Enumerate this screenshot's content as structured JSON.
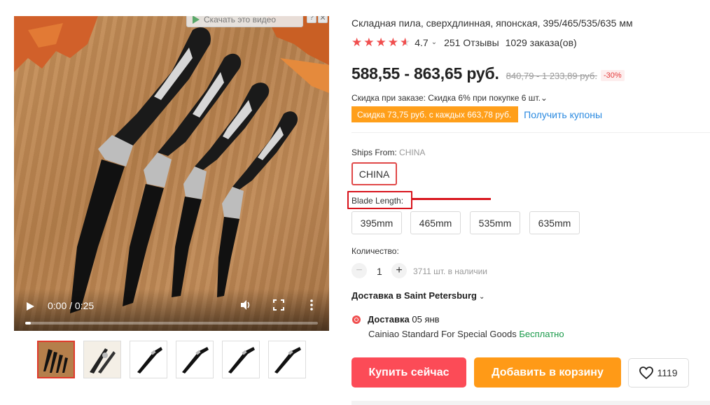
{
  "video": {
    "download_badge": "Скачать это видео",
    "help_glyph": "?",
    "close_glyph": "✕",
    "time": "0:00 / 0:25",
    "progress_fraction": 0.02
  },
  "thumbnails": [
    {
      "name": "thumbnail-1",
      "active": true
    },
    {
      "name": "thumbnail-2",
      "active": false
    },
    {
      "name": "thumbnail-3",
      "active": false
    },
    {
      "name": "thumbnail-4",
      "active": false
    },
    {
      "name": "thumbnail-5",
      "active": false
    },
    {
      "name": "thumbnail-6",
      "active": false
    }
  ],
  "product": {
    "title": "Складная пила, сверхдлинная, японская, 395/465/535/635 мм",
    "rating": "4.7",
    "rating_chevron": "⌄",
    "reviews": "251 Отзывы",
    "orders": "1029 заказа(ов)",
    "price": "588,55 - 863,65 руб.",
    "old_price": "840,79 - 1 233,89 руб.",
    "discount": "-30%",
    "bulk_discount": "Скидка при заказе: Скидка 6% при покупке 6 шт.",
    "bulk_chevron": "⌄",
    "coupon": "Скидка 73,75 руб. с каждых 663,78 руб.",
    "get_coupons": "Получить купоны"
  },
  "options": {
    "ships_from_label": "Ships From:",
    "ships_from_value": "CHINA",
    "ships_options": [
      "CHINA"
    ],
    "blade_label": "Blade Length:",
    "blade_options": [
      "395mm",
      "465mm",
      "535mm",
      "635mm"
    ]
  },
  "quantity": {
    "label": "Количество:",
    "minus": "−",
    "plus": "+",
    "value": "1",
    "stock": "3711 шт. в наличии"
  },
  "delivery": {
    "to": "Доставка в Saint Petersburg",
    "to_chevron": "⌄",
    "title": "Доставка",
    "date": "05 янв",
    "carrier": "Cainiao Standard For Special Goods",
    "cost": "Бесплатно"
  },
  "actions": {
    "buy_now": "Купить сейчас",
    "add_to_cart": "Добавить в корзину",
    "wishlist_count": "1119"
  },
  "colors": {
    "accent_red": "#fc4b57",
    "accent_orange": "#ff9a17",
    "coupon_orange": "#ff9f1a",
    "link_blue": "#2b8ae0",
    "free_green": "#1a9a4a",
    "star_red": "#f04e4e"
  }
}
